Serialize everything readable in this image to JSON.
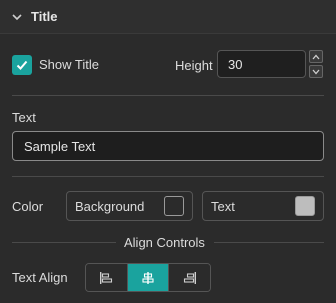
{
  "panel": {
    "title": "Title"
  },
  "show_title": {
    "label": "Show Title",
    "checked": true
  },
  "height": {
    "label": "Height",
    "value": "30"
  },
  "text_field": {
    "label": "Text",
    "value": "Sample Text"
  },
  "color": {
    "label": "Color",
    "background_label": "Background",
    "background_color": "#2b2b2b",
    "text_label": "Text",
    "text_color": "#bdbdbd"
  },
  "align_controls": {
    "section_title": "Align Controls",
    "text_align_label": "Text Align",
    "options": [
      "align-left-icon",
      "align-center-icon",
      "align-right-icon"
    ],
    "selected": "center"
  },
  "accent_color": "#1aa39e"
}
